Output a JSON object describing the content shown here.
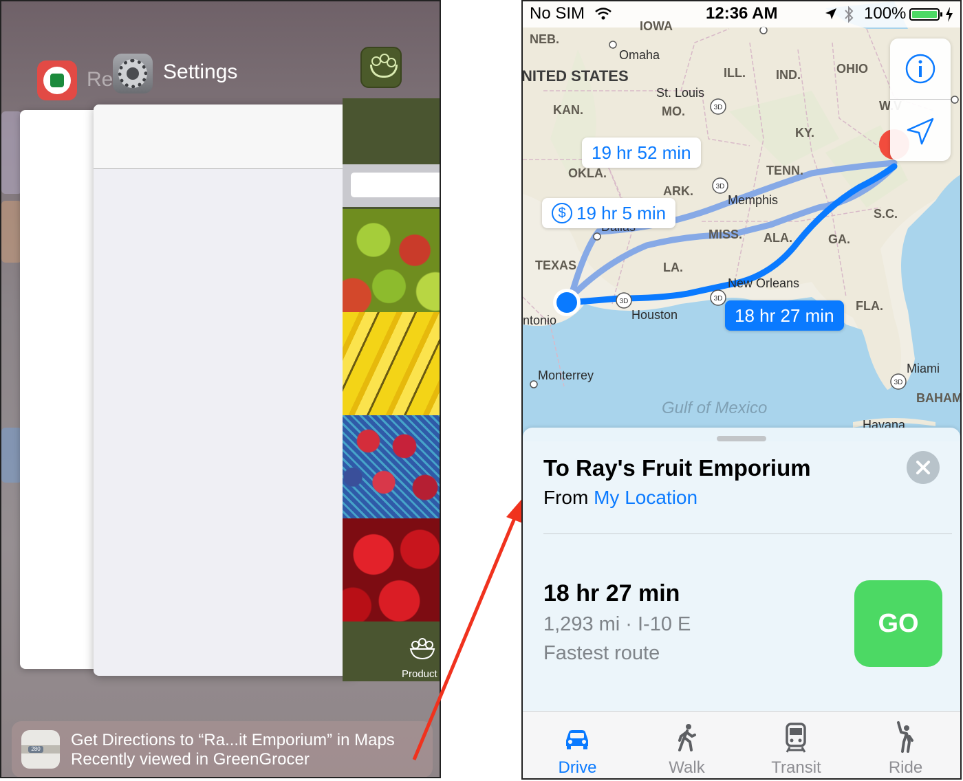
{
  "switcher": {
    "apps": [
      {
        "name": "Re",
        "icon": "reminders-icon"
      },
      {
        "name": "Settings",
        "icon": "settings-icon"
      },
      {
        "name": "GreenGrocer",
        "icon": "greengrocer-icon"
      }
    ],
    "grocer_tab_label": "Product",
    "handoff": {
      "icon": "maps-icon",
      "badge": "280",
      "title": "Get Directions to “Ra...it Emporium” in Maps",
      "subtitle": "Recently viewed in GreenGrocer"
    }
  },
  "maps": {
    "status_bar": {
      "carrier": "No SIM",
      "time": "12:36 AM",
      "battery": "100%",
      "icons": [
        "wifi-icon",
        "location-arrow-icon",
        "bluetooth-icon",
        "battery-icon",
        "charging-icon"
      ]
    },
    "map_labels": {
      "iowa": "IOWA",
      "neb": "NEB.",
      "united_states": "NITED STATES",
      "ill": "ILL.",
      "ind": "IND.",
      "ohio": "OHIO",
      "kan": "KAN.",
      "mo": "MO.",
      "wv": "W.V",
      "ky": "KY.",
      "okla": "OKLA.",
      "tenn": "TENN.",
      "ark": "ARK.",
      "sc": "S.C.",
      "miss": "MISS.",
      "ala": "ALA.",
      "ga": "GA.",
      "texas": "TEXAS",
      "la": "LA.",
      "fla": "FLA.",
      "baham": "BAHAM"
    },
    "cities": {
      "omaha": "Omaha",
      "st_louis": "St. Louis",
      "memphis": "Memphis",
      "new_orleans": "New Orleans",
      "houston": "Houston",
      "san_antonio": "ntonio",
      "monterrey": "Monterrey",
      "miami": "Miami",
      "havana": "Havana",
      "dallas": "Dallas"
    },
    "water": "Gulf of Mexico",
    "badge_3d": "3D",
    "routes": {
      "alt1": "19 hr 52 min",
      "alt2": "19 hr 5 min",
      "alt2_toll": "$",
      "main": "18 hr 27 min"
    },
    "sheet": {
      "title": "To Ray's Fruit Emporium",
      "from_label": "From",
      "from_value": "My Location",
      "time": "18 hr 27 min",
      "meta": "1,293 mi · I-10 E",
      "description": "Fastest route",
      "go": "GO"
    },
    "tabs": [
      {
        "label": "Drive",
        "icon": "car-icon",
        "active": true
      },
      {
        "label": "Walk",
        "icon": "walk-icon",
        "active": false
      },
      {
        "label": "Transit",
        "icon": "train-icon",
        "active": false
      },
      {
        "label": "Ride",
        "icon": "ride-icon",
        "active": false
      }
    ],
    "colors": {
      "accent": "#0a7aff",
      "go": "#4cd964",
      "route_alt": "#86a9e6",
      "annotation_arrow": "#f0321e"
    }
  }
}
